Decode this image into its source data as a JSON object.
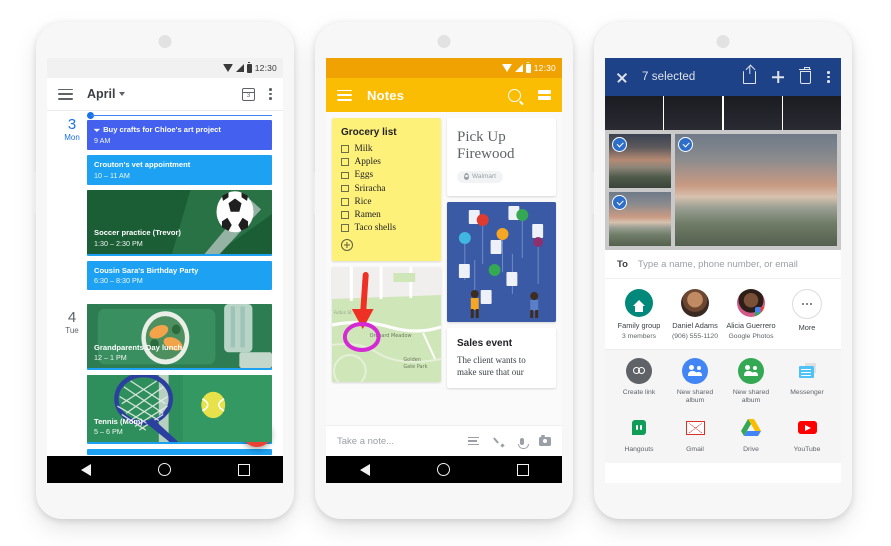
{
  "phone1": {
    "app": "calendar",
    "statusbar": {
      "time": "12:30"
    },
    "toolbar": {
      "title": "April",
      "menu_icon": "hamburger-icon",
      "calendar_icon": "calendar-day-icon",
      "overflow_icon": "kebab-menu-icon",
      "day_number": "3"
    },
    "days": [
      {
        "number": "3",
        "weekday": "Mon",
        "today": true,
        "events": [
          {
            "title": "Buy crafts for Chloe's art project",
            "time": "9 AM",
            "color": "#4361ee",
            "has_icon": true,
            "image": false
          },
          {
            "title": "Crouton's vet appointment",
            "time": "10 – 11 AM",
            "color": "#1da1f2",
            "has_icon": false,
            "image": false
          },
          {
            "title": "Soccer practice (Trevor)",
            "time": "1:30 – 2:30 PM",
            "color": "#1b5e36",
            "has_icon": false,
            "image": "soccer"
          },
          {
            "title": "Cousin Sara's Birthday Party",
            "time": "6:30 – 8:30 PM",
            "color": "#1da1f2",
            "has_icon": false,
            "image": false
          }
        ]
      },
      {
        "number": "4",
        "weekday": "Tue",
        "today": false,
        "events": [
          {
            "title": "Grandparents Day lunch",
            "time": "12 – 1 PM",
            "color": "#2e7d52",
            "has_icon": false,
            "image": "lunch"
          },
          {
            "title": "Tennis (Mom)",
            "time": "5 – 6 PM",
            "color": "#2e8b57",
            "has_icon": false,
            "image": "tennis"
          }
        ]
      }
    ],
    "fab": {
      "label": "+",
      "color": "#ea4335"
    },
    "navbar": {
      "back": "back-triangle-icon",
      "home": "home-circle-icon",
      "recents": "recents-square-icon"
    }
  },
  "phone2": {
    "app": "notes",
    "statusbar": {
      "time": "12:30"
    },
    "toolbar": {
      "title": "Notes",
      "menu_icon": "hamburger-icon",
      "search_icon": "search-icon",
      "view_icon": "view-toggle-icon",
      "color": "#fbbc04"
    },
    "notes": [
      {
        "type": "checklist",
        "title": "Grocery list",
        "items": [
          "Milk",
          "Apples",
          "Eggs",
          "Sriracha",
          "Rice",
          "Ramen",
          "Taco shells"
        ],
        "add_label": "+"
      },
      {
        "type": "image",
        "kind": "map",
        "caption": "Golden Gate Park",
        "label2": "Orchard Meadow"
      },
      {
        "type": "text",
        "title": "Pick Up Firewood",
        "location_chip": "Walmart"
      },
      {
        "type": "image",
        "kind": "photo"
      },
      {
        "type": "article",
        "title": "Sales event",
        "body": "The client wants to make sure that our"
      }
    ],
    "composer": {
      "placeholder": "Take a note...",
      "icons": [
        "list-icon",
        "brush-icon",
        "microphone-icon",
        "camera-icon"
      ]
    },
    "navbar": {
      "back": "back-triangle-icon",
      "home": "home-circle-icon",
      "recents": "recents-square-icon"
    }
  },
  "phone3": {
    "app": "photos-share",
    "toolbar": {
      "close_icon": "close-icon",
      "count_label": "7 selected",
      "share_icon": "share-icon",
      "add_icon": "plus-icon",
      "delete_icon": "trash-icon",
      "overflow_icon": "kebab-menu-icon",
      "color": "#1e4287"
    },
    "to_field": {
      "label": "To",
      "placeholder": "Type a name, phone number, or email"
    },
    "contacts": [
      {
        "name": "Family group",
        "sub": "3 members",
        "avatar": "family-group-icon"
      },
      {
        "name": "Daniel Adams",
        "sub": "(906) 555-1120",
        "avatar": "contact-photo"
      },
      {
        "name": "Alicia Guerrero",
        "sub": "Google Photos",
        "avatar": "contact-photo"
      },
      {
        "name": "More",
        "sub": "",
        "avatar": "more-icon"
      }
    ],
    "apps": [
      {
        "label": "Create link",
        "icon": "link-icon"
      },
      {
        "label": "New shared album",
        "icon": "add-people-icon"
      },
      {
        "label": "New shared album",
        "icon": "people-icon"
      },
      {
        "label": "Messenger",
        "icon": "messenger-icon"
      },
      {
        "label": "Hangouts",
        "icon": "hangouts-icon"
      },
      {
        "label": "Gmail",
        "icon": "gmail-icon"
      },
      {
        "label": "Drive",
        "icon": "drive-icon"
      },
      {
        "label": "YouTube",
        "icon": "youtube-icon"
      }
    ]
  }
}
